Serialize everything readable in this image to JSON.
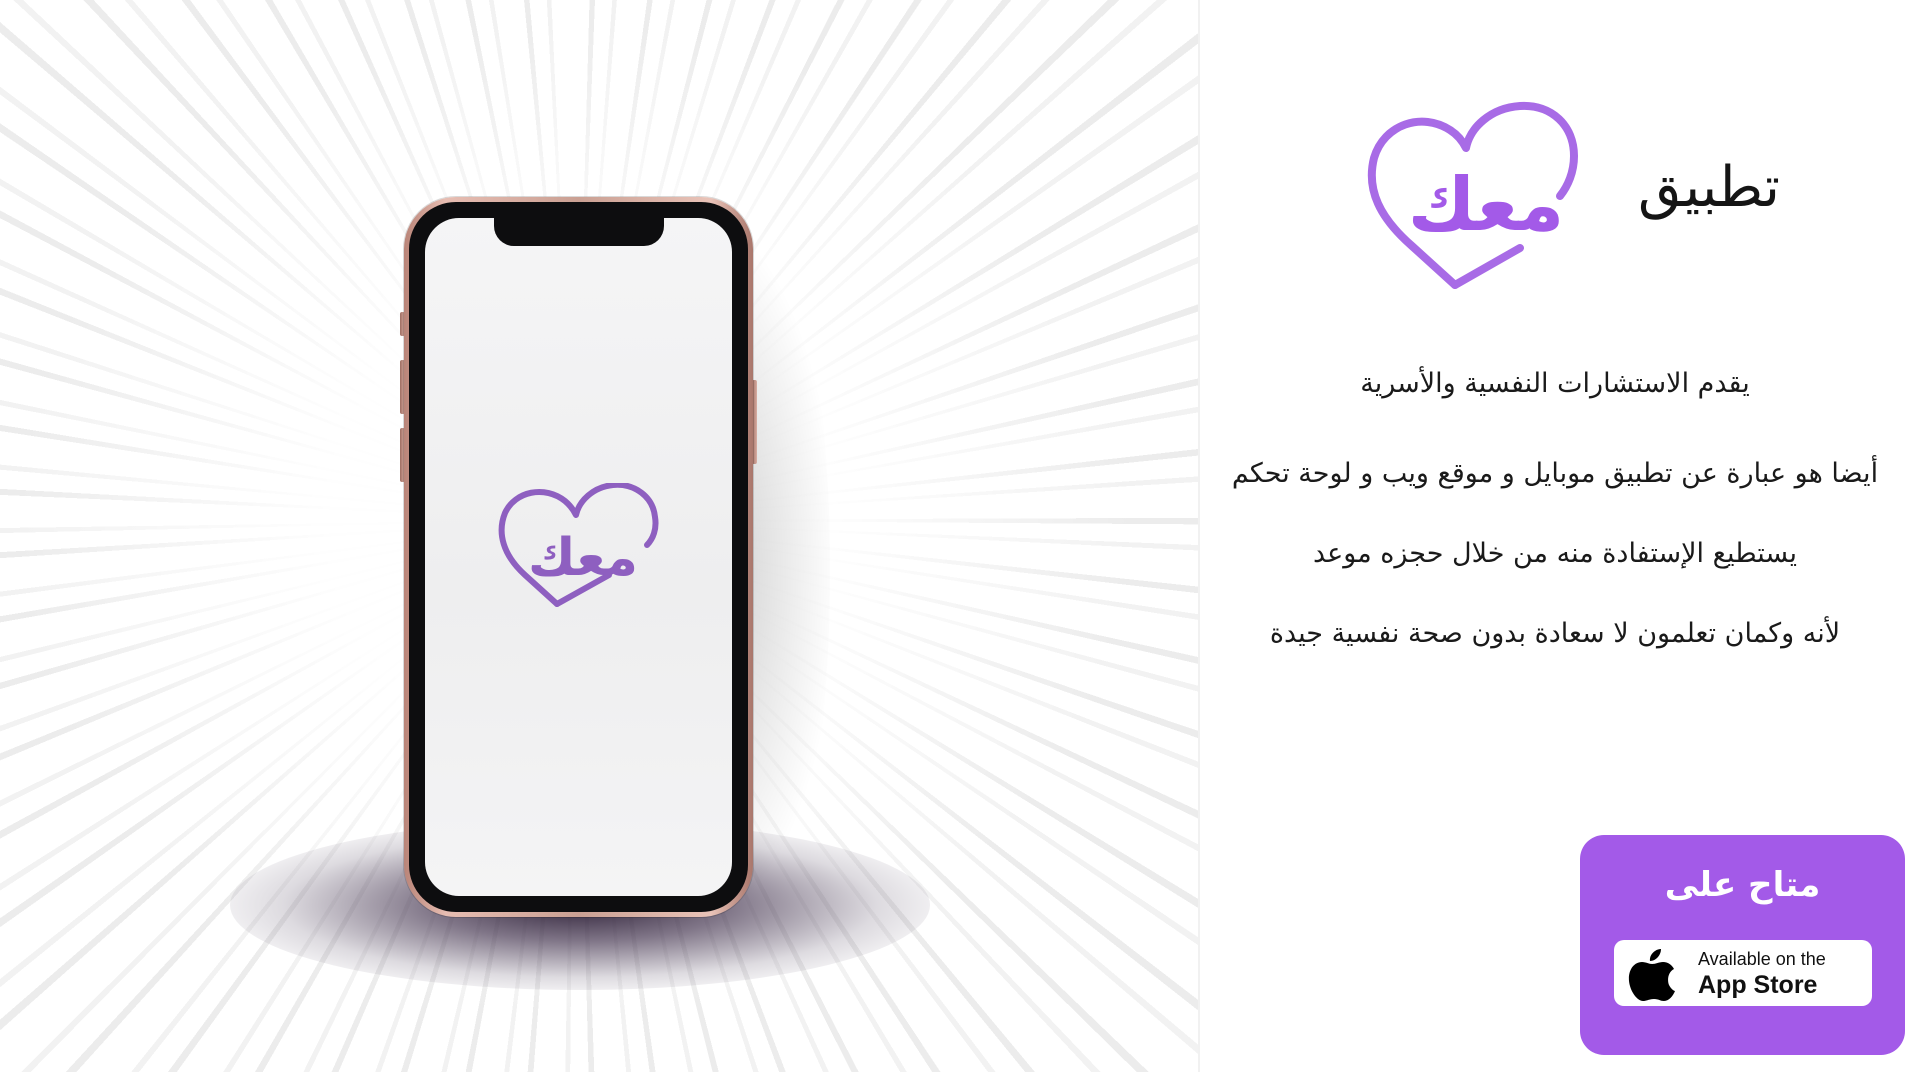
{
  "colors": {
    "brand_purple": "#A35AE8",
    "logo_purple_light": "#A86BE6",
    "splash_logo_purple": "#8E5FC0",
    "phone_frame_rose_gold": "#CAA093",
    "text_dark": "#1A1A1A"
  },
  "phone": {
    "splash_logo_text": "معك"
  },
  "brand": {
    "logo_text": "معك",
    "prefix": "تطبيق"
  },
  "description": {
    "lines": [
      "يقدم الاستشارات النفسية والأسرية",
      "أيضا هو عبارة عن تطبيق موبايل و موقع ويب و لوحة تحكم",
      "يستطيع الإستفادة منه من خلال حجزه موعد",
      "لأنه وكمان تعلمون لا سعادة بدون صحة نفسية جيدة"
    ]
  },
  "availability": {
    "title": "متاح على",
    "badge": {
      "small_text": "Available on the",
      "big_text": "App Store",
      "icon": "apple-logo-icon"
    }
  }
}
